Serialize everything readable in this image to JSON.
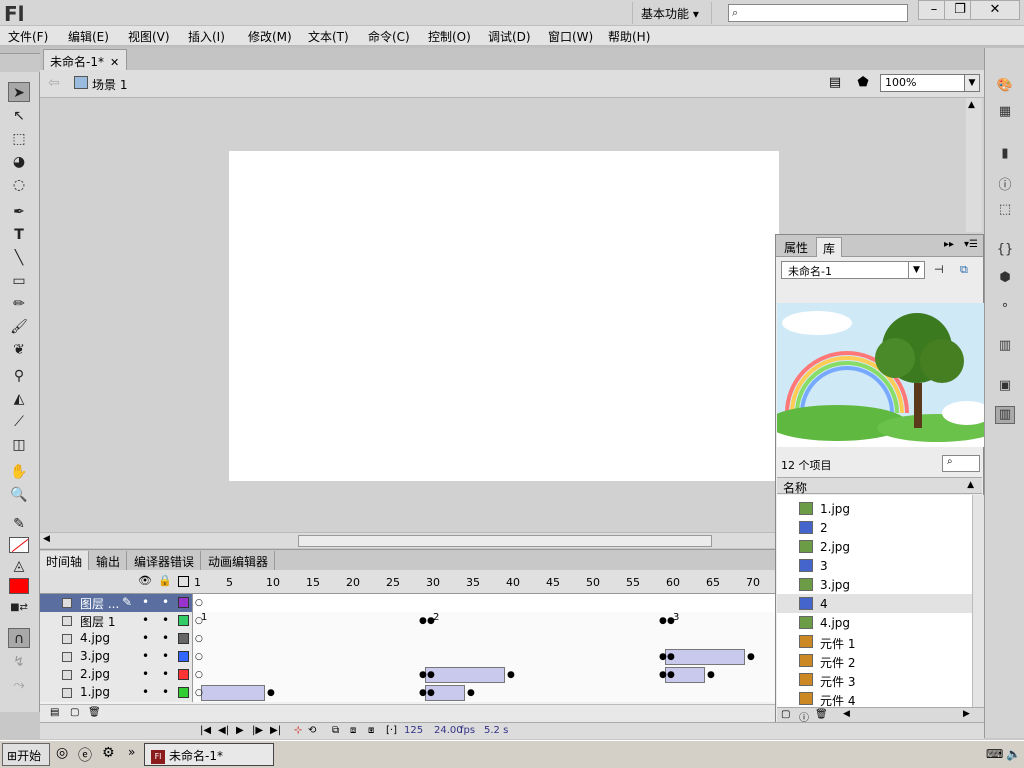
{
  "app": {
    "logo": "Fl",
    "workspace": "基本功能",
    "workspace_arrow": "▾"
  },
  "menu": [
    "文件(F)",
    "编辑(E)",
    "视图(V)",
    "插入(I)",
    "修改(M)",
    "文本(T)",
    "命令(C)",
    "控制(O)",
    "调试(D)",
    "窗口(W)",
    "帮助(H)"
  ],
  "document": {
    "tab_title": "未命名-1*",
    "scene_label": "场景 1",
    "zoom": "100%"
  },
  "library": {
    "tab_properties": "属性",
    "tab_library": "库",
    "doc_select": "未命名-1",
    "item_count": "12 个项目",
    "column_name": "名称",
    "items": [
      {
        "name": "1.jpg",
        "type": "bitmap"
      },
      {
        "name": "2",
        "type": "graphic"
      },
      {
        "name": "2.jpg",
        "type": "bitmap"
      },
      {
        "name": "3",
        "type": "graphic"
      },
      {
        "name": "3.jpg",
        "type": "bitmap"
      },
      {
        "name": "4",
        "type": "graphic",
        "selected": true
      },
      {
        "name": "4.jpg",
        "type": "bitmap"
      },
      {
        "name": "元件 1",
        "type": "symbol"
      },
      {
        "name": "元件 2",
        "type": "symbol"
      },
      {
        "name": "元件 3",
        "type": "symbol"
      },
      {
        "name": "元件 4",
        "type": "symbol"
      }
    ]
  },
  "timeline": {
    "tabs": [
      "时间轴",
      "输出",
      "编译器错误",
      "动画编辑器"
    ],
    "ruler": [
      "1",
      "5",
      "10",
      "15",
      "20",
      "25",
      "30",
      "35",
      "40",
      "45",
      "50",
      "55",
      "60",
      "65",
      "70"
    ],
    "layers": [
      {
        "name": "图层 ...",
        "color": "#9933cc",
        "selected": true,
        "pencil": "✎"
      },
      {
        "name": "图层 1",
        "color": "#33cc66",
        "labels": [
          "1",
          "2",
          "3"
        ]
      },
      {
        "name": "4.jpg",
        "color": "#666666"
      },
      {
        "name": "3.jpg",
        "color": "#3366ff"
      },
      {
        "name": "2.jpg",
        "color": "#ff3333"
      },
      {
        "name": "1.jpg",
        "color": "#33cc33"
      }
    ],
    "current_frame": "125",
    "fps": "24.00",
    "fps_unit": "fps",
    "time": "5.2 s"
  },
  "taskbar": {
    "start": "开始",
    "window": "未命名-1*",
    "more": "»"
  },
  "colors": {
    "stroke": "#ff0000",
    "fill": "#ff0000"
  }
}
